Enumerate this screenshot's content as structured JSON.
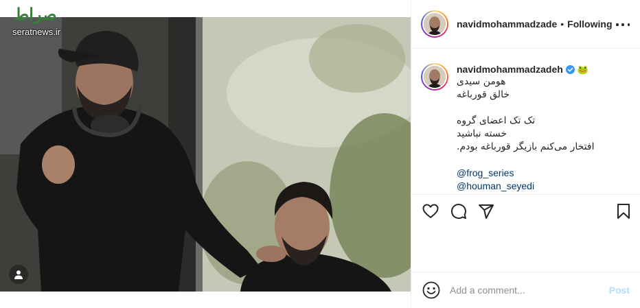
{
  "watermark": {
    "script": "صراط",
    "site": "seratnews.ir"
  },
  "header": {
    "username": "navidmohammadzade",
    "separator": "•",
    "follow_status": "Following"
  },
  "caption": {
    "username": "navidmohammadzadeh",
    "emoji": "🐸",
    "lines": [
      "هومن سیدی",
      "خالق قورباغه",
      "",
      "تک تک اعضای گروه",
      "خسته نباشید",
      "افتخار می‌کنم بازیگر قورباغه بودم."
    ],
    "mentions": [
      "@frog_series",
      "@houman_seyedi"
    ]
  },
  "actions": {
    "icons": [
      "heart-icon",
      "comment-icon",
      "share-icon",
      "bookmark-icon"
    ]
  },
  "comment": {
    "placeholder": "Add a comment...",
    "post_label": "Post"
  },
  "colors": {
    "link": "#00376b",
    "verified": "#3897f0",
    "post_disabled": "#b2dffc",
    "border": "#efefef"
  }
}
